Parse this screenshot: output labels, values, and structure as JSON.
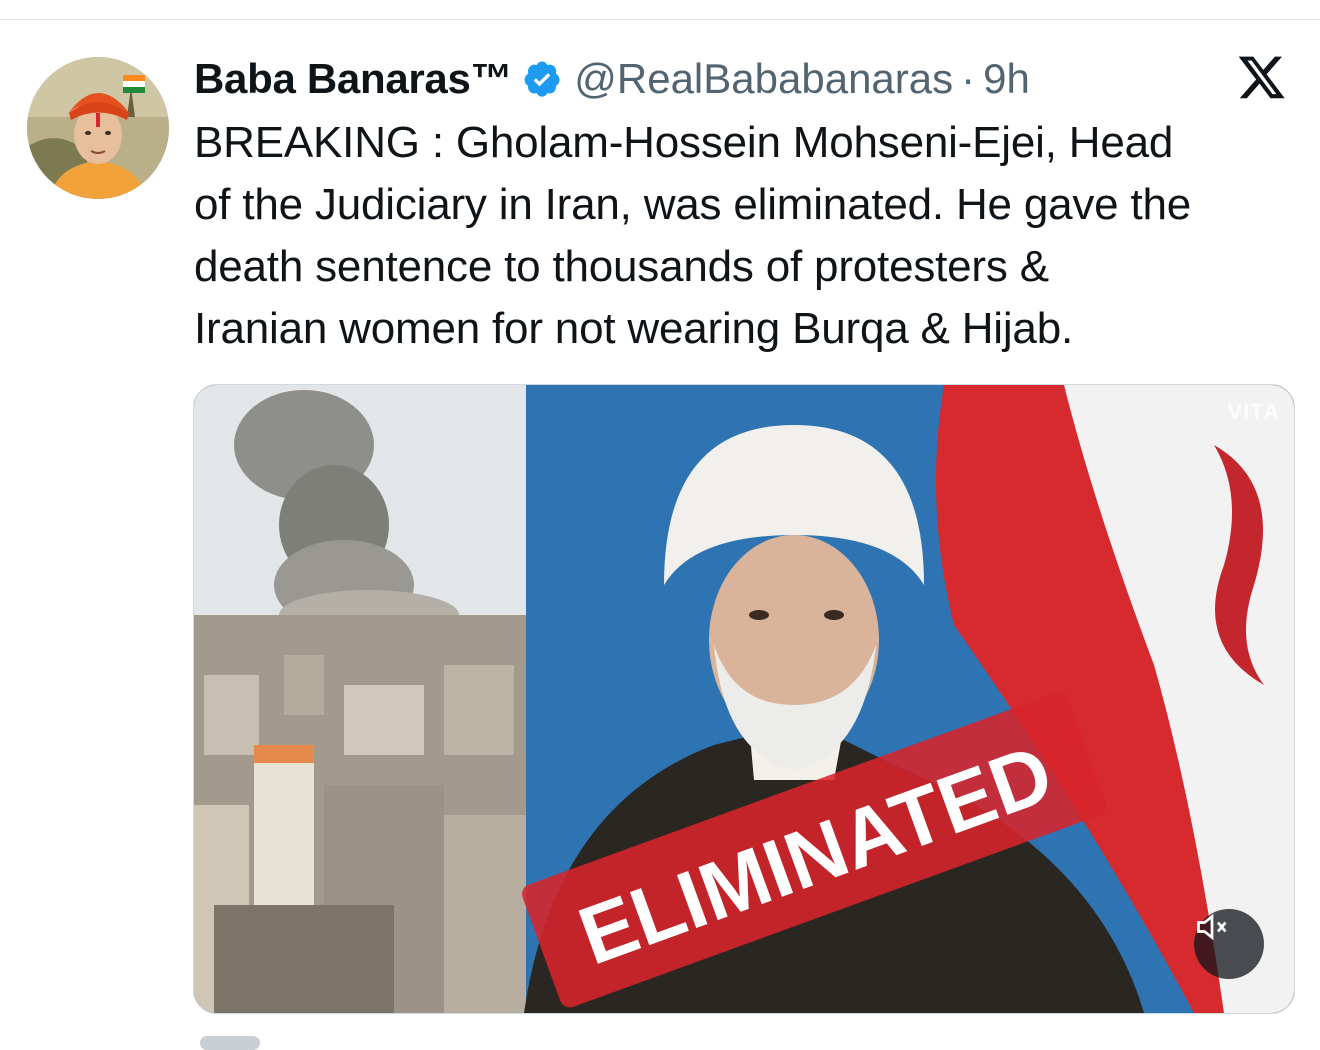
{
  "tweet": {
    "author_name": "Baba Banaras™",
    "handle": "@RealBababanaras",
    "separator": "·",
    "time": "9h",
    "verified": true,
    "text_lines": [
      "BREAKING : Gholam-Hossein Mohseni-Ejei, Head",
      "of the Judiciary in Iran, was eliminated. He gave the",
      "death sentence to thousands of protesters &",
      "Iranian women for not wearing Burqa & Hijab."
    ]
  },
  "media": {
    "overlay_text": "ELIMINATED",
    "watermark": "VITA",
    "mute_icon": "speaker-muted-icon"
  },
  "icons": {
    "logo": "x-logo-icon",
    "verified": "verified-badge-icon"
  },
  "colors": {
    "verified_blue": "#1d9bf0",
    "text": "#0f1419",
    "secondary_text": "#536471",
    "stamp_red": "#d8242b"
  }
}
